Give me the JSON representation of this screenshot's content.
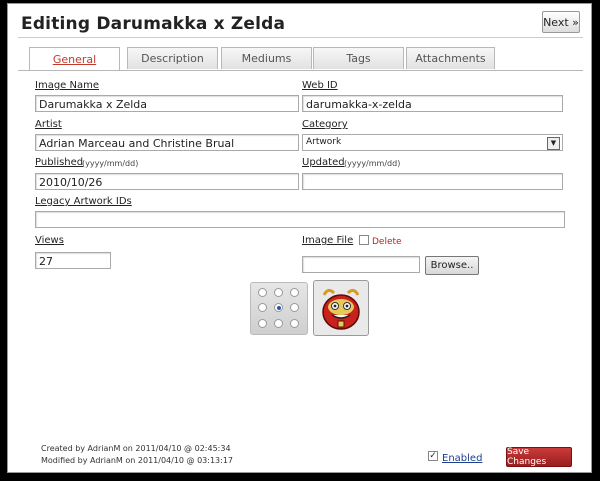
{
  "header": {
    "title": "Editing Darumakka x Zelda",
    "next_label": "Next »"
  },
  "tabs": [
    {
      "label": "General",
      "active": true
    },
    {
      "label": "Description",
      "active": false
    },
    {
      "label": "Mediums",
      "active": false
    },
    {
      "label": "Tags",
      "active": false
    },
    {
      "label": "Attachments",
      "active": false
    }
  ],
  "form": {
    "image_name": {
      "label": "Image Name",
      "value": "Darumakka x Zelda"
    },
    "web_id": {
      "label": "Web ID",
      "value": "darumakka-x-zelda"
    },
    "artist": {
      "label": "Artist",
      "value": "Adrian Marceau and Christine Brual"
    },
    "category": {
      "label": "Category",
      "value": "Artwork"
    },
    "published": {
      "label": "Published",
      "hint": "(yyyy/mm/dd)",
      "value": "2010/10/26"
    },
    "updated": {
      "label": "Updated",
      "hint": "(yyyy/mm/dd)",
      "value": ""
    },
    "legacy": {
      "label": "Legacy Artwork IDs",
      "value": ""
    },
    "views": {
      "label": "Views",
      "value": "27"
    },
    "image_file": {
      "label": "Image File",
      "delete_label": "Delete",
      "browse_label": "Browse..",
      "value": "",
      "delete_checked": false
    }
  },
  "alignment": {
    "selected": 4
  },
  "footer": {
    "created": "Created by AdrianM on 2011/04/10 @ 02:45:34",
    "modified": "Modified by AdrianM on 2011/04/10 @ 03:13:17",
    "enabled_label": "Enabled",
    "enabled_checked": true,
    "save_label": "Save Changes"
  },
  "colors": {
    "accent": "#c0392b",
    "save": "#a82424",
    "link": "#1f3f8f"
  },
  "icons": {
    "thumbnail": "darumakka-thumbnail",
    "checkbox": "checkbox-icon"
  }
}
